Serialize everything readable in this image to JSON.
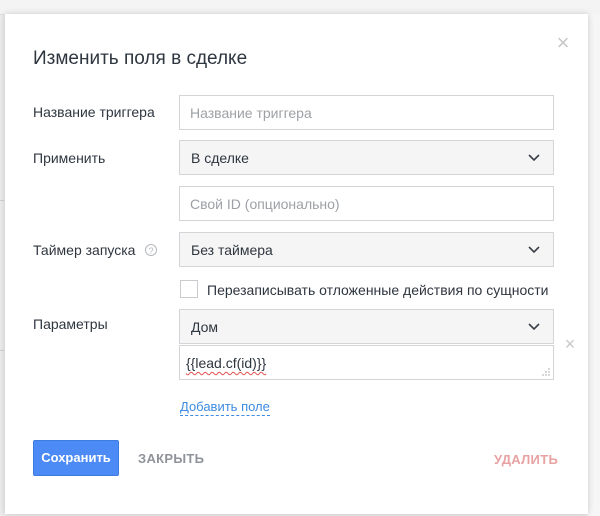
{
  "modal": {
    "title": "Изменить поля в сделке",
    "close_icon": "close-icon"
  },
  "fields": {
    "trigger_name": {
      "label": "Название триггера",
      "value": "",
      "placeholder": "Название триггера"
    },
    "apply": {
      "label": "Применить",
      "selected": "В сделке"
    },
    "custom_id": {
      "value": "",
      "placeholder": "Свой ID (опционально)"
    },
    "timer": {
      "label": "Таймер запуска",
      "selected": "Без таймера",
      "info_icon": "info-icon"
    },
    "overwrite": {
      "label": "Перезаписывать отложенные действия по сущности",
      "checked": false
    },
    "params": {
      "label": "Параметры",
      "field_selected": "Дом",
      "field_value": "{{lead.cf(id)}}",
      "remove_icon": "close-icon"
    },
    "add_field_link": "Добавить поле"
  },
  "buttons": {
    "save": "Сохранить",
    "close": "ЗАКРЫТЬ",
    "delete": "УДАЛИТЬ"
  },
  "colors": {
    "accent": "#4c8bf5",
    "link": "#3d8be0",
    "danger_muted": "#e7a2a2",
    "text": "#2e3640",
    "muted": "#8f9399"
  }
}
